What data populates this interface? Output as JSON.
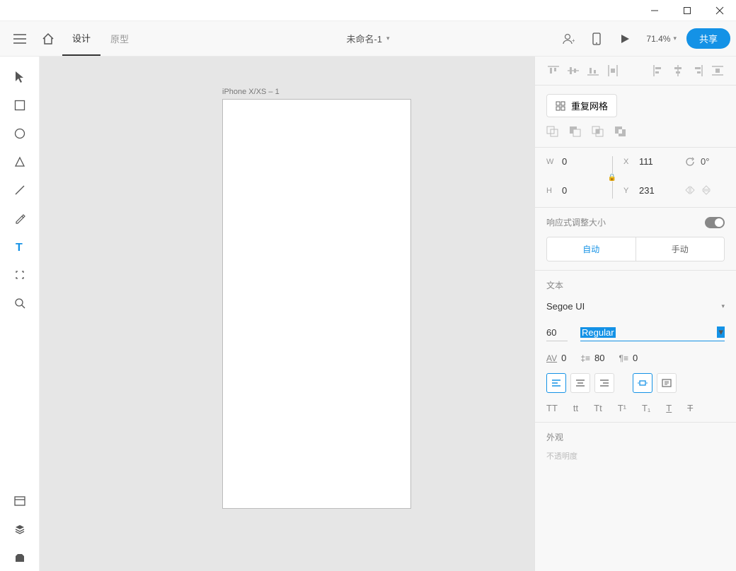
{
  "window": {
    "title": ""
  },
  "tabs": {
    "design": "设计",
    "prototype": "原型"
  },
  "doc": {
    "name": "未命名-1"
  },
  "zoom": {
    "value": "71.4%"
  },
  "share": {
    "label": "共享"
  },
  "artboard": {
    "label": "iPhone X/XS – 1"
  },
  "repeat": {
    "label": "重复网格"
  },
  "geom": {
    "w_label": "W",
    "w": "0",
    "h_label": "H",
    "h": "0",
    "x_label": "X",
    "x": "111",
    "y_label": "Y",
    "y": "231",
    "rot": "0°"
  },
  "responsive": {
    "label": "响应式调整大小",
    "auto": "自动",
    "manual": "手动"
  },
  "text": {
    "section_label": "文本",
    "font": "Segoe UI",
    "size": "60",
    "weight": "Regular",
    "char_spacing": "0",
    "line_spacing": "80",
    "para_spacing": "0"
  },
  "appearance": {
    "label": "外观",
    "opacity_label": "不透明度"
  },
  "transform": {
    "tt_upper": "TT",
    "tt_lower": "tt",
    "tt_title": "Tt",
    "sup": "T¹",
    "sub": "T₁",
    "underline": "T",
    "strike": "T"
  }
}
